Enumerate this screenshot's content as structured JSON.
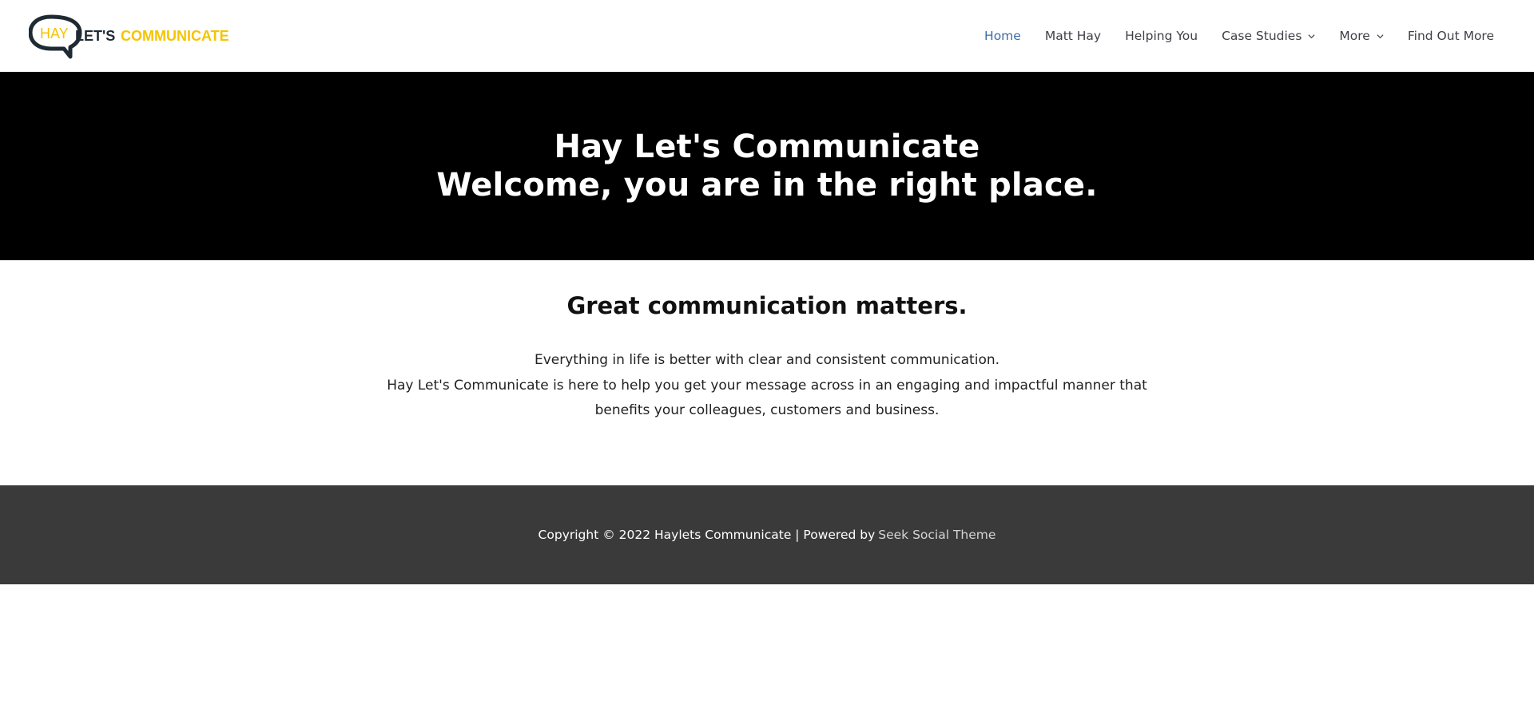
{
  "logo": {
    "word_hay": "HAY",
    "word_lets": "LET'S",
    "word_communicate": "COMMUNICATE",
    "colors": {
      "dark": "#1f2a33",
      "accent": "#f5c400"
    }
  },
  "nav": {
    "items": [
      {
        "label": "Home",
        "active": true
      },
      {
        "label": "Matt Hay"
      },
      {
        "label": "Helping You"
      },
      {
        "label": "Case Studies",
        "dropdown": true
      },
      {
        "label": "More",
        "dropdown": true
      },
      {
        "label": "Find Out More"
      }
    ],
    "colors": {
      "default": "#3f3f46",
      "active": "#3a6ea5"
    }
  },
  "hero": {
    "line1": "Hay Let's Communicate",
    "line2": "Welcome, you are in the right place."
  },
  "content": {
    "heading": "Great communication matters.",
    "line1": "Everything in life is better with clear and consistent communication.",
    "line2": "Hay Let's Communicate is here to help you get your message across in an engaging and impactful manner that",
    "line3": "benefits your colleagues, customers and business."
  },
  "footer": {
    "text": "Copyright © 2022 Haylets Communicate | Powered by",
    "link": "Seek Social Theme",
    "background": "#3a3a3a"
  }
}
